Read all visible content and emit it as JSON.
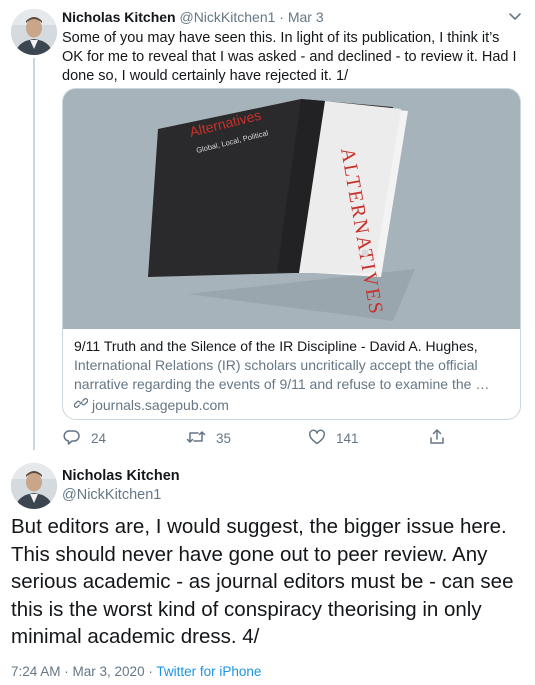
{
  "tweet1": {
    "name": "Nicholas Kitchen",
    "handle": "@NickKitchen1",
    "separator": " · ",
    "date": "Mar 3",
    "text": "Some of you may have seen this. In light of its publication, I think it’s OK for me to reveal that I was asked - and declined - to review it. Had I done so, I would certainly have rejected it. 1/",
    "card": {
      "image_title": "Alternatives",
      "image_subtitle": "Global, Local, Political",
      "image_spine": "ALTERNATIVES",
      "title": "9/11 Truth and the Silence of the IR Discipline - David A. Hughes,",
      "description": "International Relations (IR) scholars uncritically accept the official narrative regarding the events of 9/11 and refuse to examine the …",
      "domain": "journals.sagepub.com"
    },
    "actions": {
      "replies": "24",
      "retweets": "35",
      "likes": "141"
    }
  },
  "tweet2": {
    "name": "Nicholas Kitchen",
    "handle": "@NickKitchen1",
    "text": "But editors are, I would suggest, the bigger issue here. This should never have gone out to peer review. Any serious academic - as journal editors must be - can see this is the worst kind of conspiracy theorising in only minimal academic dress. 4/",
    "time": "7:24 AM",
    "separator": " · ",
    "date": "Mar 3, 2020",
    "separator2": " · ",
    "source": "Twitter for iPhone"
  },
  "colors": {
    "accent": "#1b95e0",
    "muted": "#657786",
    "border": "#ccd6dd",
    "cover_red": "#c8312b"
  },
  "icons": [
    "reply-icon",
    "retweet-icon",
    "like-icon",
    "share-icon",
    "chevron-down-icon",
    "link-icon"
  ]
}
